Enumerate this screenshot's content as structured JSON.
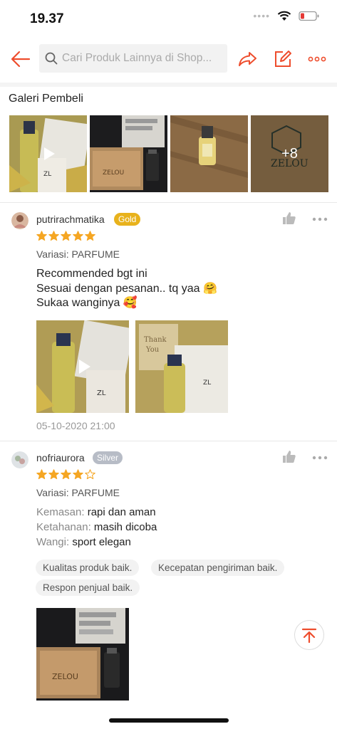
{
  "status_bar": {
    "time": "19.37"
  },
  "colors": {
    "accent": "#ee4d2d",
    "star": "#f5a623"
  },
  "header": {
    "search_placeholder": "Cari Produk Lainnya di Shop...",
    "icons": [
      "back-arrow-icon",
      "search-icon",
      "share-icon",
      "edit-icon",
      "more-icon"
    ]
  },
  "gallery": {
    "title": "Galeri Pembeli",
    "more_count": "+8"
  },
  "reviews": [
    {
      "username": "putrirachmatika",
      "badge": "Gold",
      "rating": 5,
      "variant": "Variasi: PARFUME",
      "lines": [
        "Recommended bgt ini",
        "Sesuai dengan pesanan.. tq yaa 🤗",
        "Sukaa wanginya 🥰"
      ],
      "date": "05-10-2020 21:00"
    },
    {
      "username": "nofriaurora",
      "badge": "Silver",
      "rating": 4,
      "variant": "Variasi: PARFUME",
      "details": [
        {
          "label": "Kemasan:",
          "value": "rapi dan aman"
        },
        {
          "label": "Ketahanan:",
          "value": "masih dicoba"
        },
        {
          "label": "Wangi:",
          "value": "sport elegan"
        }
      ],
      "tags": [
        "Kualitas produk baik.",
        "Kecepatan pengiriman baik.",
        "Respon penjual baik."
      ]
    }
  ]
}
